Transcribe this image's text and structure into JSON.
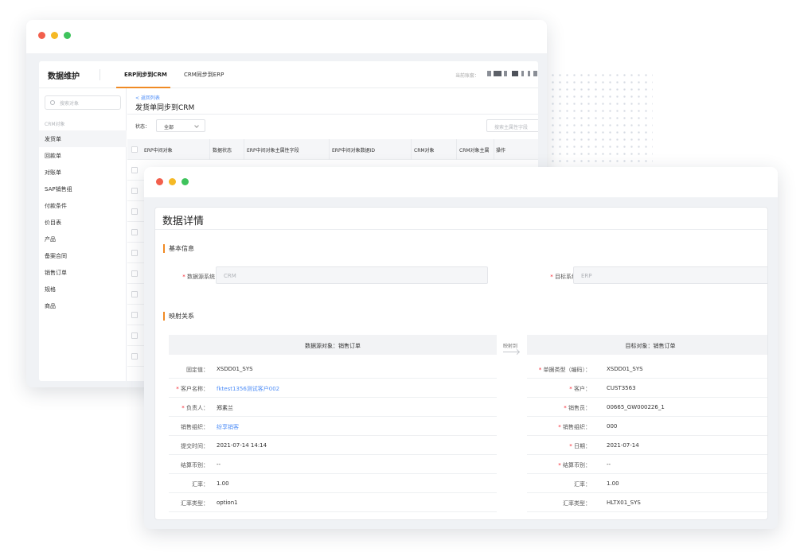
{
  "colors": {
    "accent": "#f08a24",
    "link": "#4f8ef7",
    "required": "#f5222d",
    "traffic_red": "#f25f4c",
    "traffic_yellow": "#f5b925",
    "traffic_green": "#3ec35c"
  },
  "back_window": {
    "brand": "数据维护",
    "tabs": [
      {
        "label": "ERP同步到CRM",
        "active": true
      },
      {
        "label": "CRM同步到ERP",
        "active": false
      }
    ],
    "account_label": "当前账套：",
    "sidebar": {
      "search_placeholder": "搜索对象",
      "group_label": "CRM对象",
      "items": [
        {
          "label": "发货单",
          "active": true
        },
        {
          "label": "回款单"
        },
        {
          "label": "对账单"
        },
        {
          "label": "SAP销售组"
        },
        {
          "label": "付款条件"
        },
        {
          "label": "价目表"
        },
        {
          "label": "产品"
        },
        {
          "label": "备案合同"
        },
        {
          "label": "销售订单"
        },
        {
          "label": "规格"
        },
        {
          "label": "商品"
        }
      ]
    },
    "main": {
      "back_link": "< 返回列表",
      "title": "发货单同步到CRM",
      "filter_label": "状态：",
      "filter_value": "全部",
      "search_placeholder": "搜索主属性字段",
      "columns": [
        "ERP中间对象",
        "数据状态",
        "ERP中间对象主属性字段",
        "ERP中间对象数据ID",
        "CRM对象",
        "CRM对象主属",
        "操作"
      ]
    }
  },
  "front_window": {
    "title": "数据详情",
    "basic_section": "基本信息",
    "source_system_label": "数据源系统",
    "source_system_value": "CRM",
    "target_system_label": "目标系统",
    "target_system_value": "ERP",
    "mapping_section": "映射关系",
    "source_object_header": "数据源对象：销售订单",
    "mapped_to": "映射到",
    "target_object_header": "目标对象：销售订单",
    "source_rows": [
      {
        "label": "固定值：",
        "value": "XSDD01_SYS",
        "required": false,
        "link": false
      },
      {
        "label": "客户名称：",
        "value": "fktest1356测试客户002",
        "required": true,
        "link": true
      },
      {
        "label": "负责人：",
        "value": "郑素兰",
        "required": true,
        "link": false
      },
      {
        "label": "销售组织：",
        "value": "纷享销客",
        "required": false,
        "link": true
      },
      {
        "label": "提交时间：",
        "value": "2021-07-14 14:14",
        "required": false,
        "link": false
      },
      {
        "label": "结算币别：",
        "value": "--",
        "required": false,
        "link": false
      },
      {
        "label": "汇率：",
        "value": "1.00",
        "required": false,
        "link": false
      },
      {
        "label": "汇率类型：",
        "value": "option1",
        "required": false,
        "link": false
      }
    ],
    "target_rows": [
      {
        "label": "单据类型（编码）：",
        "value": "XSDD01_SYS",
        "required": true
      },
      {
        "label": "客户：",
        "value": "CUST3563",
        "required": true
      },
      {
        "label": "销售员：",
        "value": "00665_GW000226_1",
        "required": true
      },
      {
        "label": "销售组织：",
        "value": "000",
        "required": true
      },
      {
        "label": "日期：",
        "value": "2021-07-14",
        "required": true
      },
      {
        "label": "结算币别：",
        "value": "--",
        "required": true
      },
      {
        "label": "汇率：",
        "value": "1.00",
        "required": false
      },
      {
        "label": "汇率类型：",
        "value": "HLTX01_SYS",
        "required": false
      }
    ]
  }
}
